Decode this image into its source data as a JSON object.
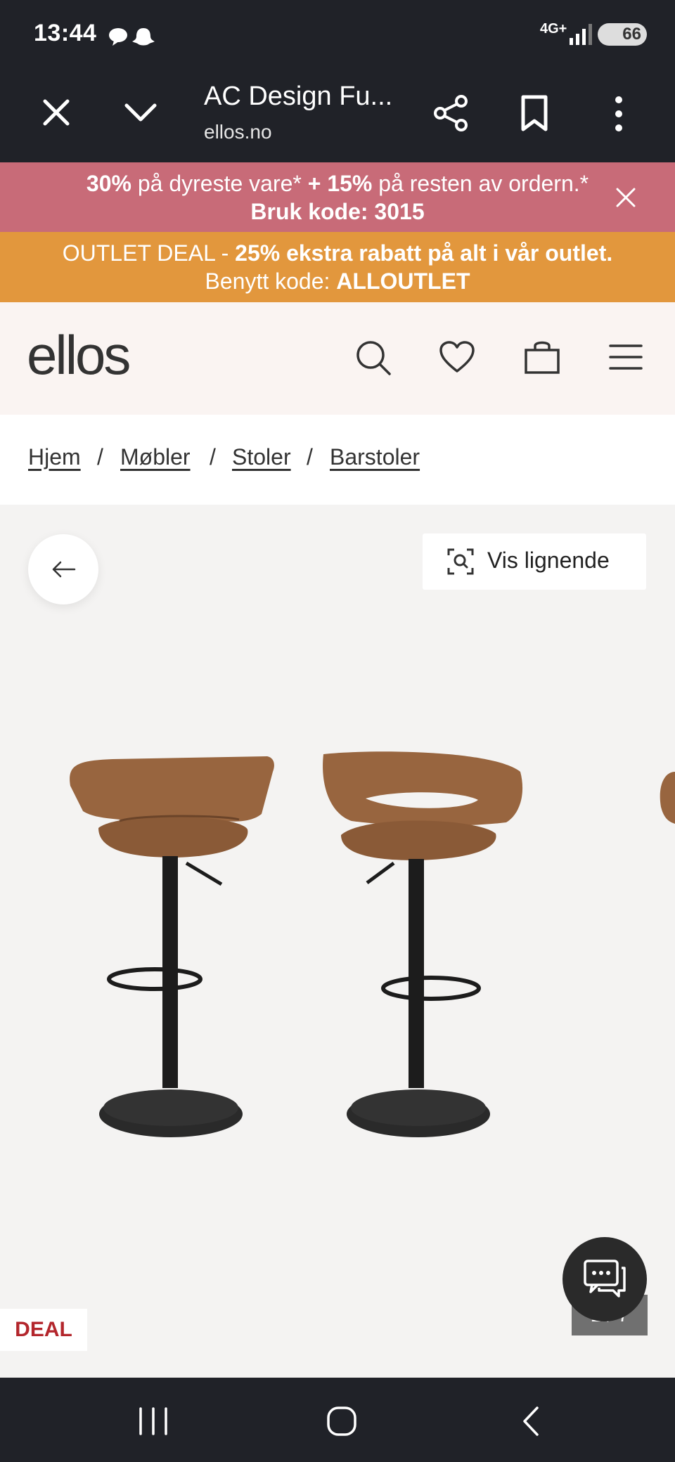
{
  "status_bar": {
    "time": "13:44",
    "network": "4G+",
    "battery": "66"
  },
  "browser": {
    "page_title": "AC Design Fu...",
    "url": "ellos.no"
  },
  "promo_banner": {
    "discount1": "30%",
    "text1": " på dyreste vare* ",
    "discount2": "+ 15%",
    "text2": " på resten av ordern.* ",
    "code_text": "Bruk kode: 3015",
    "bg_color": "#c86b78"
  },
  "outlet_banner": {
    "prefix": "OUTLET DEAL - ",
    "highlight": "25% ekstra rabatt på alt i vår outlet.",
    "code_prefix": " Benytt kode: ",
    "code": "ALLOUTLET",
    "bg_color": "#e2973d"
  },
  "site_header": {
    "logo": "ellos"
  },
  "breadcrumb": {
    "items": [
      "Hjem",
      "Møbler",
      "Stoler",
      "Barstoler"
    ],
    "separator": "/"
  },
  "gallery": {
    "similar_label": "Vis lignende",
    "deal_badge": "DEAL",
    "counter": "1 / 7"
  }
}
